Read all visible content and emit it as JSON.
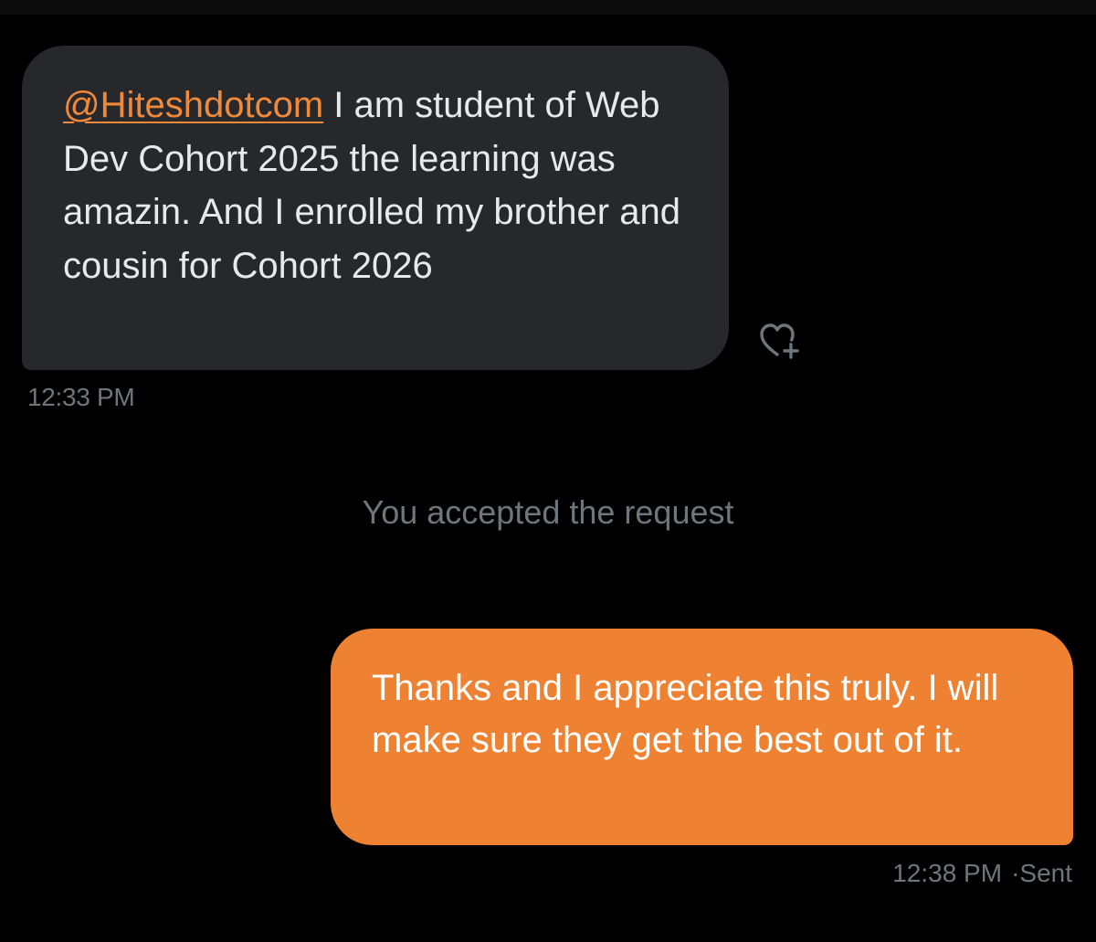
{
  "conversation": {
    "incoming": {
      "mention": "@Hiteshdotcom",
      "text": " I am student of Web Dev Cohort 2025 the learning was amazin. And I enrolled my brother and cousin for Cohort 2026",
      "time": "12:33 PM",
      "react_icon": "heart-plus-icon"
    },
    "system": {
      "text": "You accepted the request"
    },
    "outgoing": {
      "text": "Thanks and I appreciate this truly. I will make sure they get the best out of it.",
      "time": "12:38 PM",
      "separator": "·",
      "status": "Sent"
    }
  },
  "colors": {
    "background": "#000000",
    "incoming_bubble": "#26282c",
    "outgoing_bubble": "#ee8132",
    "mention": "#f0893a",
    "muted_text": "#6e767d"
  }
}
